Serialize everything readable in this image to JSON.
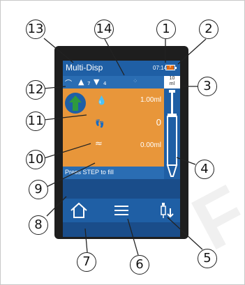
{
  "screen": {
    "title": "Multi-Disp",
    "time": "07:14",
    "volume": {
      "line1": "10",
      "line2": "ml"
    },
    "up_count": "7",
    "down_count": "4",
    "values": {
      "volume": "1.00ml",
      "steps": "0",
      "remaining": "0.00ml"
    },
    "message": "Press STEP to fill"
  },
  "callouts": [
    "1",
    "2",
    "3",
    "4",
    "5",
    "6",
    "7",
    "8",
    "9",
    "10",
    "11",
    "12",
    "13",
    "14"
  ],
  "colors": {
    "header": "#1f5fa5",
    "panel": "#e8963a",
    "accent_green": "#2e9a3e"
  },
  "icons": [
    "battery-icon",
    "speed-icon",
    "up-triangle-icon",
    "down-triangle-icon",
    "drops-icon",
    "fill-arrow-icon",
    "drop-icon",
    "footsteps-icon",
    "waves-icon",
    "syringe-icon",
    "home-icon",
    "menu-icon",
    "pipette-down-icon"
  ]
}
